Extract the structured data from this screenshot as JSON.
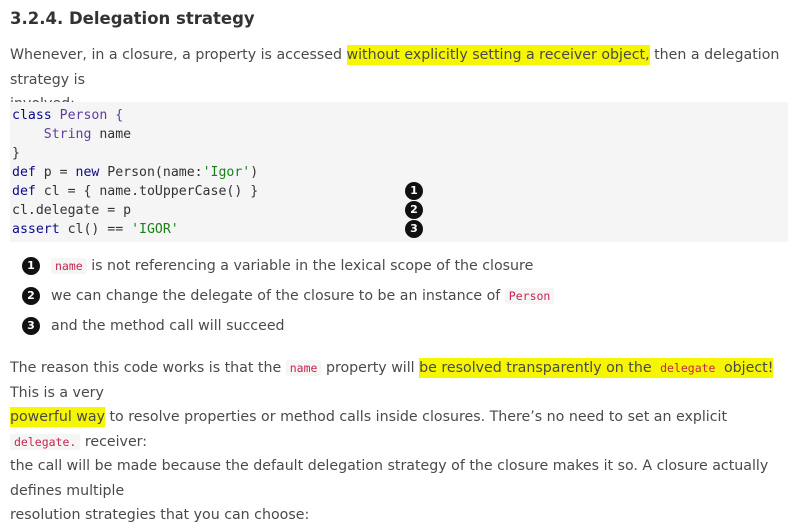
{
  "section": {
    "title": "3.2.4. Delegation strategy"
  },
  "intro": {
    "before": "Whenever, in a closure, a property is accessed ",
    "highlight": "without explicitly setting a receiver object,",
    "after_line1": " then a delegation strategy is",
    "line2": "involved:"
  },
  "code": {
    "l1_kw": "class",
    "l1_name": " Person {",
    "l2_type": "String",
    "l2_rest": " name",
    "l3": "}",
    "l4_kw": "def",
    "l4_a": " p = ",
    "l4_kw2": "new",
    "l4_b": " Person(name:",
    "l4_str": "'Igor'",
    "l4_c": ")",
    "l5_kw": "def",
    "l5_rest": " cl = { name.toUpperCase() }",
    "l6": "cl.delegate = p",
    "l7_kw": "assert",
    "l7_a": " cl() == ",
    "l7_str": "'IGOR'",
    "callouts": [
      "1",
      "2",
      "3"
    ]
  },
  "colist": [
    {
      "num": "1",
      "code": "name",
      "text": " is not referencing a variable in the lexical scope of the closure"
    },
    {
      "num": "2",
      "text": "we can change the delegate of the closure to be an instance of ",
      "code": "Person"
    },
    {
      "num": "3",
      "text": "and the method call will succeed"
    }
  ],
  "explain": {
    "l1_a": "The reason this code works is that the ",
    "l1_code": "name",
    "l1_b": " property will ",
    "l1_hl_a": "be resolved transparently on the ",
    "l1_hl_code": "delegate",
    "l1_hl_b": " object!",
    "l1_c": " This is a very",
    "l2_hl": "powerful way",
    "l2_a": " to resolve properties or method calls inside closures. There’s no need to set an explicit ",
    "l2_code": "delegate.",
    "l2_b": " receiver:",
    "l3": "the call will be made because the default delegation strategy of the closure makes it so. A closure actually defines multiple",
    "l4": "resolution strategies that you can choose:"
  },
  "colors": {
    "highlight": "#f6f600",
    "inline_code": "#c7254e",
    "code_bg": "#f5f5f5"
  }
}
